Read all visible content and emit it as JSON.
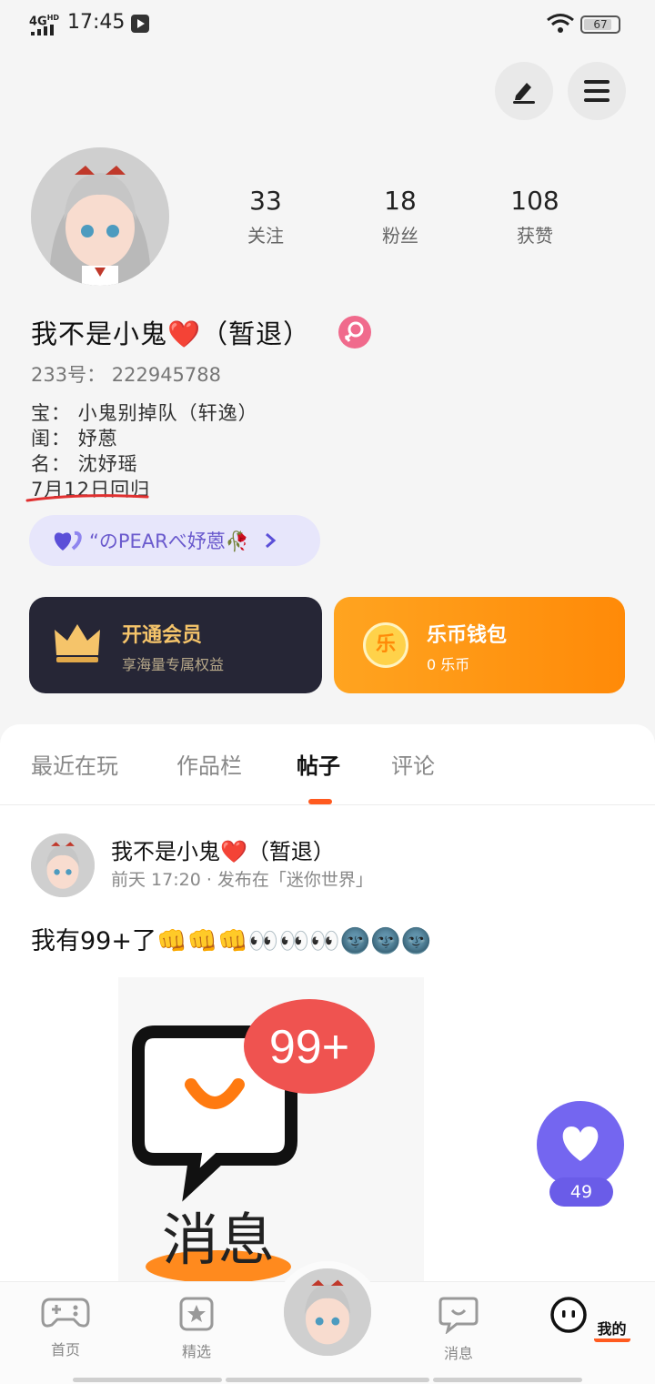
{
  "status_bar": {
    "network": "4G",
    "network_sup": "HD",
    "time": "17:45",
    "battery": "67"
  },
  "profile": {
    "stats": [
      {
        "value": "33",
        "label": "关注"
      },
      {
        "value": "18",
        "label": "粉丝"
      },
      {
        "value": "108",
        "label": "获赞"
      }
    ],
    "name": "我不是小鬼❤️（暂退）",
    "uid": "233号：  222945788",
    "bio_lines": [
      "宝：  小鬼别掉队（轩逸）",
      "闺：  妤蒽",
      "名：  沈妤瑶",
      "7月12日回归"
    ],
    "guild_pill": "“のPEARべ妤蒽🥀",
    "vip_card": {
      "title": "开通会员",
      "subtitle": "享海量专属权益"
    },
    "coin_card": {
      "title": "乐币钱包",
      "subtitle": "0 乐币",
      "icon_char": "乐"
    }
  },
  "tabs": [
    "最近在玩",
    "作品栏",
    "帖子",
    "评论"
  ],
  "active_tab": "帖子",
  "post": {
    "author": "我不是小鬼❤️（暂退）",
    "meta": "前天 17:20 · 发布在「迷你世界」",
    "text": "我有99+了👊👊👊👀👀👀🌚🌚🌚",
    "image": {
      "badge": "99+",
      "caption": "消息"
    }
  },
  "like_count": "49",
  "bottom_nav": [
    {
      "label": "首页",
      "icon": "gamepad-icon"
    },
    {
      "label": "精选",
      "icon": "star-icon"
    },
    {
      "label": "消息",
      "icon": "message-icon"
    },
    {
      "label": "我的",
      "icon": "profile-face-icon"
    }
  ],
  "colors": {
    "accent": "#ff5a1f",
    "like_purple": "#7466f0",
    "vip_dark": "#262636",
    "coin_orange": "#ff9512",
    "gold": "#f5c46a"
  }
}
